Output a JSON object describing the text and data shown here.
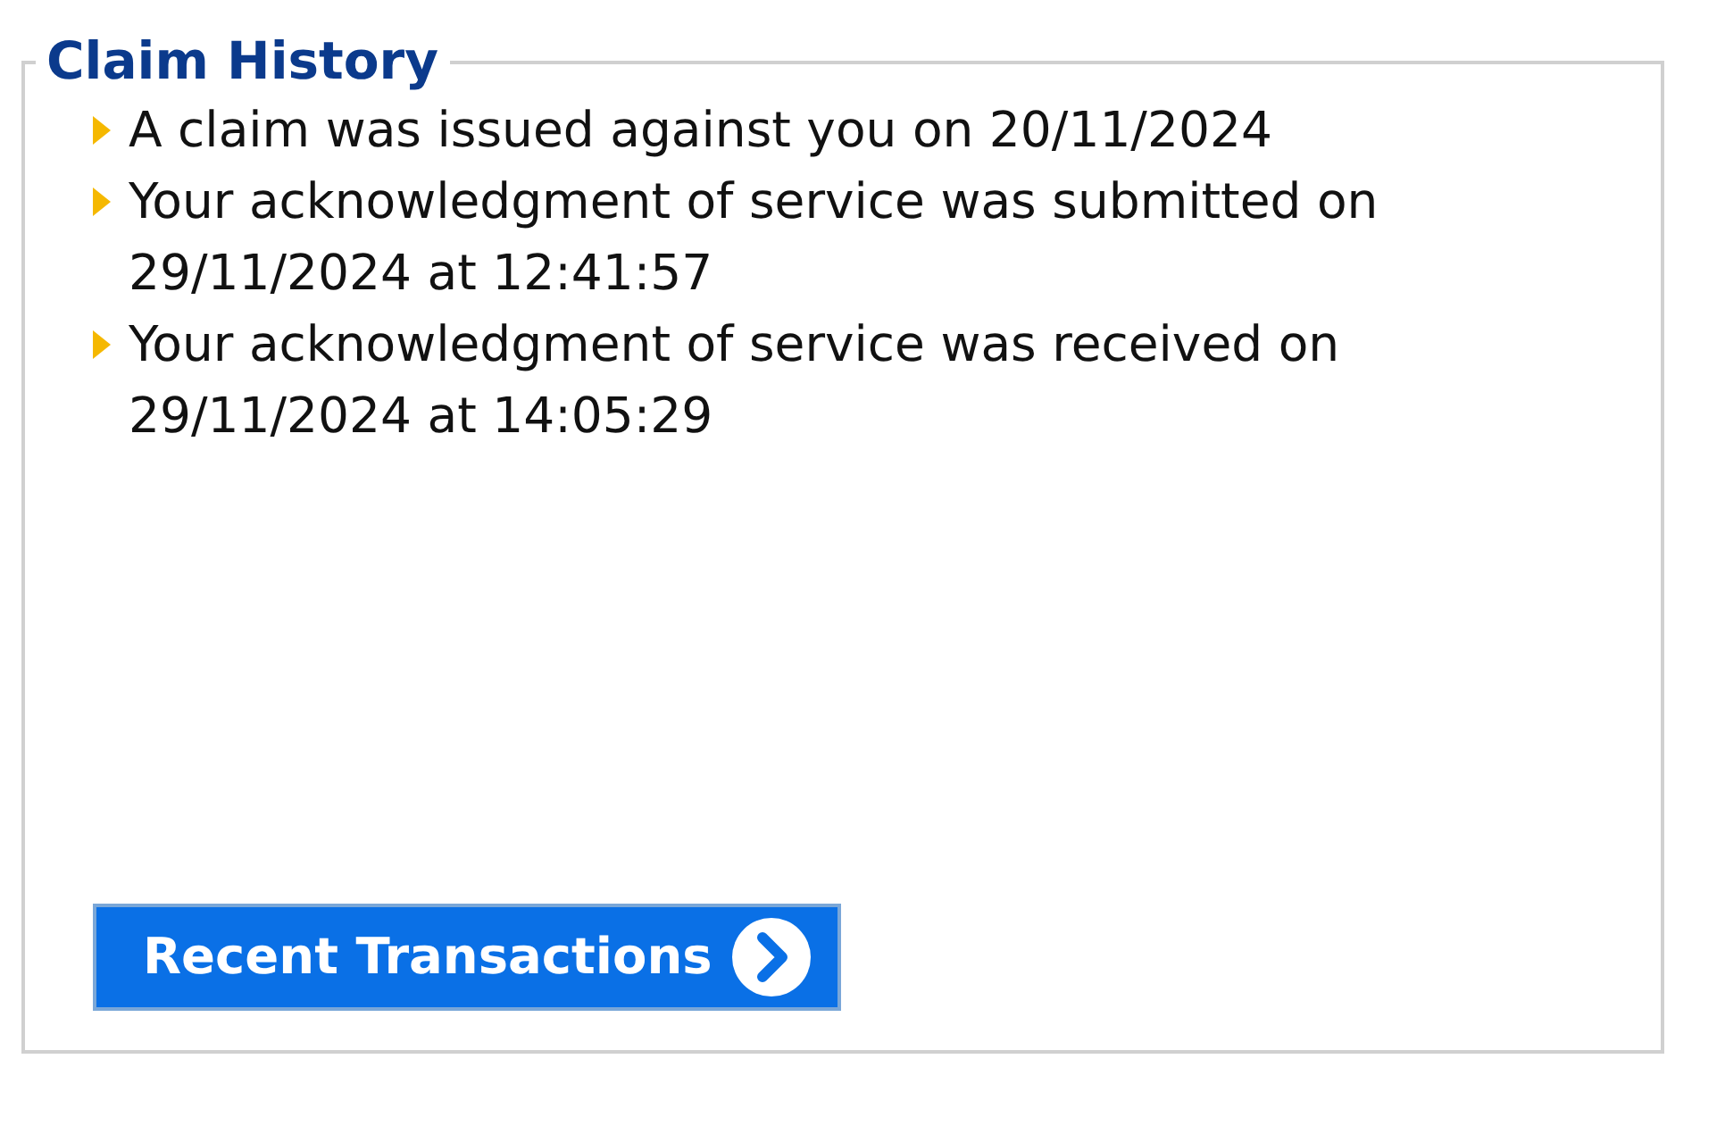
{
  "section": {
    "title": "Claim History"
  },
  "history": [
    {
      "text": "A claim was issued against you on 20/11/2024"
    },
    {
      "text": "Your acknowledgment of service was submitted on 29/11/2024 at 12:41:57"
    },
    {
      "text": "Your acknowledgment of service was received on 29/11/2024 at 14:05:29"
    }
  ],
  "button": {
    "label": "Recent Transactions"
  }
}
